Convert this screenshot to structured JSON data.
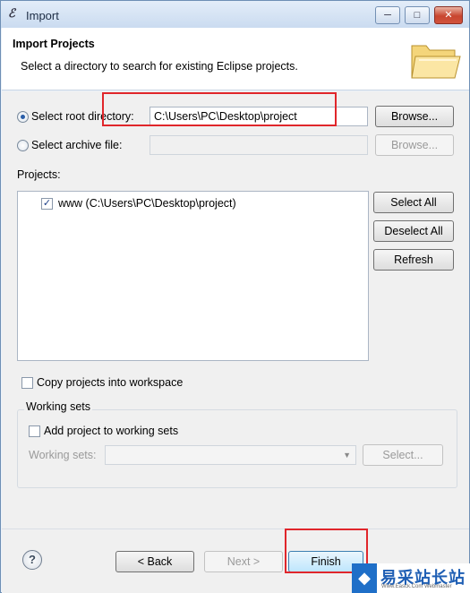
{
  "window": {
    "title": "Import",
    "controls": {
      "minimize": "─",
      "maximize": "□",
      "close": "✕"
    }
  },
  "header": {
    "title": "Import Projects",
    "description": "Select a directory to search for existing Eclipse projects."
  },
  "source": {
    "root_option_label": "Select root directory:",
    "root_value": "C:\\Users\\PC\\Desktop\\project",
    "root_browse": "Browse...",
    "archive_option_label": "Select archive file:",
    "archive_value": "",
    "archive_browse": "Browse..."
  },
  "projects": {
    "label": "Projects:",
    "items": [
      {
        "label": "www (C:\\Users\\PC\\Desktop\\project)",
        "checked": true
      }
    ],
    "select_all": "Select All",
    "deselect_all": "Deselect All",
    "refresh": "Refresh"
  },
  "options": {
    "copy_label": "Copy projects into workspace"
  },
  "working_sets": {
    "group_label": "Working sets",
    "add_label": "Add project to working sets",
    "field_label": "Working sets:",
    "select_button": "Select..."
  },
  "footer": {
    "help": "?",
    "back": "< Back",
    "next": "Next >",
    "finish": "Finish"
  },
  "watermark": {
    "logo": "◆",
    "text": "易采站长站",
    "subtext": "Www.Easck.Com Webmaster"
  },
  "colors": {
    "highlight": "#e0262b",
    "accent": "#2a5ea8"
  }
}
